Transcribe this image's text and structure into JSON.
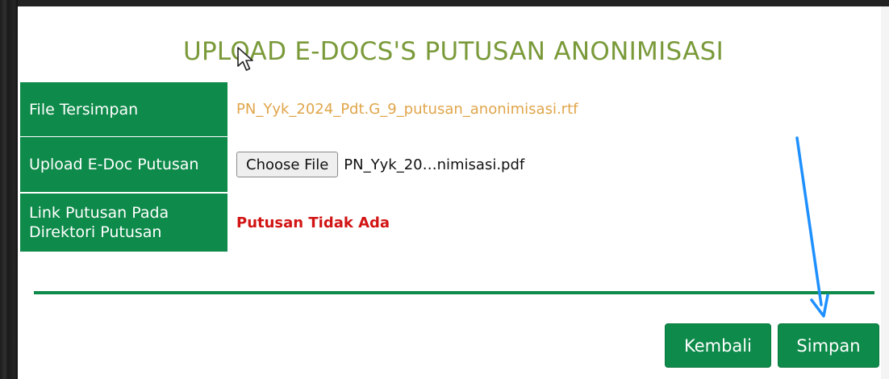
{
  "dialog": {
    "title": "UPLOAD E-DOCS'S PUTUSAN ANONIMISASI"
  },
  "form": {
    "rows": [
      {
        "label": "File Tersimpan",
        "value": "PN_Yyk_2024_Pdt.G_9_putusan_anonimisasi.rtf"
      },
      {
        "label": "Upload E-Doc Putusan",
        "button_label": "Choose File",
        "value": "PN_Yyk_20…nimisasi.pdf"
      },
      {
        "label_line1": "Link Putusan Pada",
        "label_line2": "Direktori Putusan",
        "value": "Putusan Tidak Ada"
      }
    ]
  },
  "footer": {
    "back_label": "Kembali",
    "save_label": "Simpan"
  },
  "colors": {
    "primary_green": "#0e8a4a",
    "title_olive": "#7a9a3a",
    "saved_file_orange": "#e0a54a",
    "status_red": "#d21414",
    "annotation_blue": "#1e90ff"
  },
  "icons": {
    "cursor": "mouse-pointer-icon",
    "annotation": "annotation-arrow-icon"
  }
}
